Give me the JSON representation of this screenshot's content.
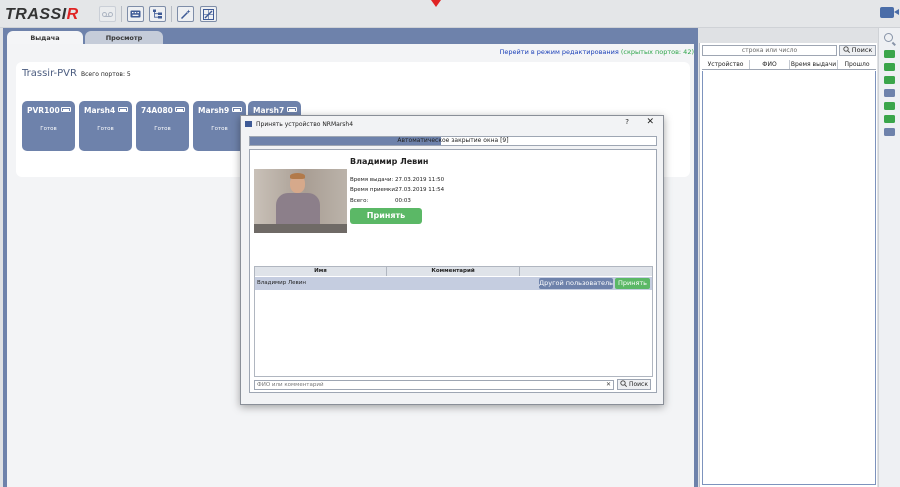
{
  "brand": {
    "logo_main": "TRASSI",
    "logo_accent": "R"
  },
  "toolbar": {
    "icons": [
      "tape-icon",
      "keyboard-icon",
      "tree-icon",
      "magic-wand-icon",
      "edit-grid-icon"
    ]
  },
  "tabs": [
    {
      "label": "Выдача"
    },
    {
      "label": "Просмотр"
    }
  ],
  "main": {
    "edit_link": "Перейти в режим редактирования",
    "hidden_ports": "(скрытых портов: 42)",
    "pvr": {
      "title": "Trassir-PVR",
      "ports": "Всего портов: 5",
      "devices": [
        {
          "name": "PVR100",
          "status": "Готов"
        },
        {
          "name": "Marsh4",
          "status": "Готов"
        },
        {
          "name": "74A080",
          "status": "Готов"
        },
        {
          "name": "Marsh9",
          "status": "Готов"
        },
        {
          "name": "Marsh7",
          "status": ""
        }
      ]
    }
  },
  "right_panel": {
    "search_placeholder": "строка или число",
    "search_button": "Поиск",
    "columns": [
      "Устройство",
      "ФИО",
      "Время выдачи",
      "Прошло"
    ]
  },
  "modal": {
    "title": "Принять устройство NRMarsh4",
    "help": "?",
    "close": "✕",
    "auto_close": "Автоматическое закрытие окна [9]",
    "auto_close_progress": 0.47,
    "user_name": "Владимир Левин",
    "issue_time_label": "Время выдачи:",
    "issue_time": "27.03.2019 11:50",
    "accept_time_label": "Время приемки:",
    "accept_time": "27.03.2019 11:54",
    "total_label": "Всего:",
    "total": "00:03",
    "accept_button": "Принять",
    "list": {
      "col_name": "Имя",
      "col_comment": "Комментарий",
      "rows": [
        {
          "name": "Владимир Левин"
        }
      ],
      "other_user_button": "Другой пользователь",
      "accept_button": "Принять"
    },
    "search_placeholder": "ФИО или комментарий",
    "search_clear": "✕",
    "search_button": "Поиск"
  },
  "colors": {
    "accent": "#6e82ab",
    "accept_green": "#5bb866",
    "logo_red": "#e02424"
  }
}
